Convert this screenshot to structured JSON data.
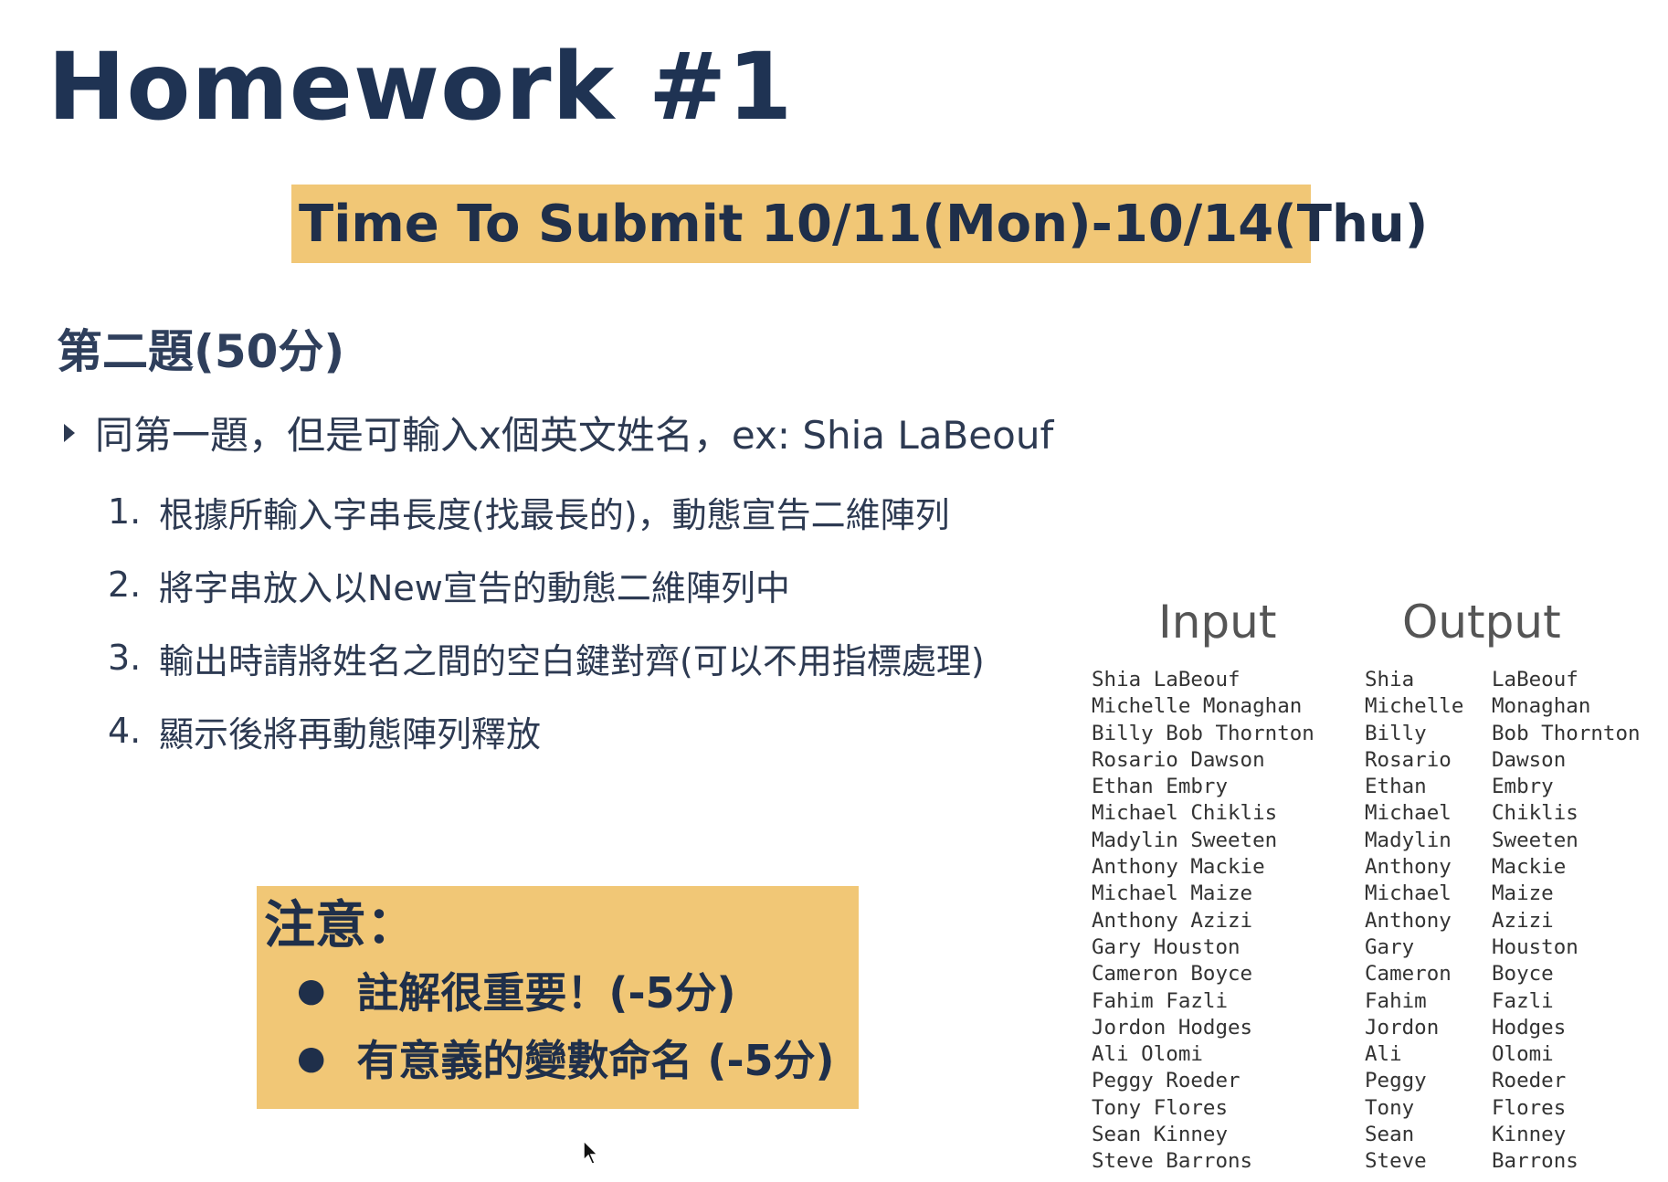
{
  "title": "Homework #1",
  "submit_banner": "Time To Submit  10/11(Mon)-10/14(Thu)",
  "question": {
    "title": "第二題(50分)",
    "bullet": "同第一題，但是可輸入x個英文姓名，ex:  Shia LaBeouf",
    "steps": [
      {
        "num": "1.",
        "text": "根據所輸入字串長度(找最長的)，動態宣告二維陣列"
      },
      {
        "num": "2.",
        "text": "將字串放入以New宣告的動態二維陣列中"
      },
      {
        "num": "3.",
        "text": "輸出時請將姓名之間的空白鍵對齊(可以不用指標處理)"
      },
      {
        "num": "4.",
        "text": "顯示後將再動態陣列釋放"
      }
    ]
  },
  "note": {
    "title": "注意：",
    "items": [
      "註解很重要！(-5分)",
      "有意義的變數命名 (-5分)"
    ]
  },
  "io": {
    "input_label": "Input",
    "output_label": "Output",
    "input_names": [
      "Shia LaBeouf",
      "Michelle Monaghan",
      "Billy Bob Thornton",
      "Rosario Dawson",
      "Ethan Embry",
      "Michael Chiklis",
      "Madylin Sweeten",
      "Anthony Mackie",
      "Michael Maize",
      "Anthony Azizi",
      "Gary Houston",
      "Cameron Boyce",
      "Fahim Fazli",
      "Jordon Hodges",
      "Ali Olomi",
      "Peggy Roeder",
      "Tony Flores",
      "Sean Kinney",
      "Steve Barrons"
    ],
    "output_first": [
      "Shia",
      "Michelle",
      "Billy",
      "Rosario",
      "Ethan",
      "Michael",
      "Madylin",
      "Anthony",
      "Michael",
      "Anthony",
      "Gary",
      "Cameron",
      "Fahim",
      "Jordon",
      "Ali",
      "Peggy",
      "Tony",
      "Sean",
      "Steve"
    ],
    "output_last": [
      "LaBeouf",
      "Monaghan",
      "Bob Thornton",
      "Dawson",
      "Embry",
      "Chiklis",
      "Sweeten",
      "Mackie",
      "Maize",
      "Azizi",
      "Houston",
      "Boyce",
      "Fazli",
      "Hodges",
      "Olomi",
      "Roeder",
      "Flores",
      "Kinney",
      "Barrons"
    ]
  },
  "icons": {
    "bullet": "triangle-right-icon",
    "cursor": "mouse-pointer-icon"
  },
  "colors": {
    "title": "#1f3353",
    "highlight": "#f1c776",
    "text": "#2d3a52"
  }
}
